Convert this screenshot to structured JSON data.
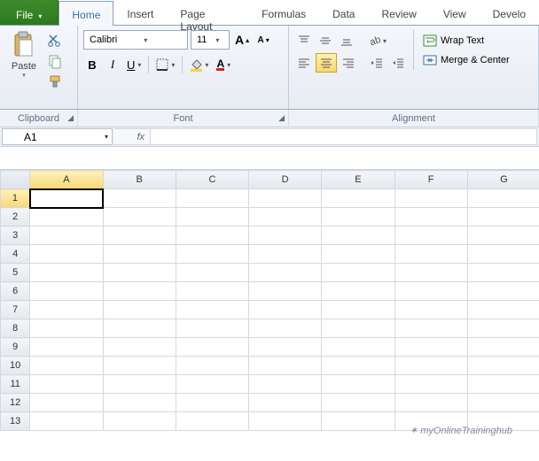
{
  "tabs": {
    "file": "File",
    "items": [
      "Home",
      "Insert",
      "Page Layout",
      "Formulas",
      "Data",
      "Review",
      "View",
      "Develo"
    ],
    "active": "Home"
  },
  "ribbon": {
    "clipboard": {
      "paste": "Paste",
      "label": "Clipboard"
    },
    "font": {
      "name": "Calibri",
      "size": "11",
      "bold": "B",
      "italic": "I",
      "underline": "U",
      "label": "Font"
    },
    "alignment": {
      "wrap": "Wrap Text",
      "merge": "Merge & Center",
      "label": "Alignment"
    }
  },
  "formula_bar": {
    "namebox": "A1",
    "fx": "fx"
  },
  "grid": {
    "cols": [
      "A",
      "B",
      "C",
      "D",
      "E",
      "F",
      "G"
    ],
    "rows": [
      "1",
      "2",
      "3",
      "4",
      "5",
      "6",
      "7",
      "8",
      "9",
      "10",
      "11",
      "12",
      "13"
    ],
    "selected": {
      "col": "A",
      "row": "1"
    }
  },
  "watermark": {
    "text": "myOnlineTraininghub"
  }
}
